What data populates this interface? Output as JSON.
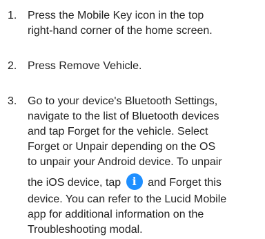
{
  "steps": [
    {
      "number": "1.",
      "lines": [
        "Press the Mobile Key icon in the top",
        "right-hand corner of the home screen."
      ]
    },
    {
      "number": "2.",
      "lines": [
        "Press Remove Vehicle."
      ]
    },
    {
      "number": "3.",
      "lines": [
        "Go to your device's Bluetooth Settings,",
        "navigate to the list of Bluetooth devices",
        "and tap Forget for the vehicle. Select",
        "Forget or Unpair depending on the OS",
        "to unpair your Android device. To unpair"
      ],
      "icon_line_before": "the iOS device, tap",
      "icon_name": "info-icon",
      "icon_glyph": "i",
      "icon_color": "#1f8fff",
      "icon_line_after": "and Forget this",
      "trailing_lines": [
        "device. You can refer to the Lucid Mobile",
        "app for additional information on the",
        "Troubleshooting modal."
      ]
    }
  ]
}
